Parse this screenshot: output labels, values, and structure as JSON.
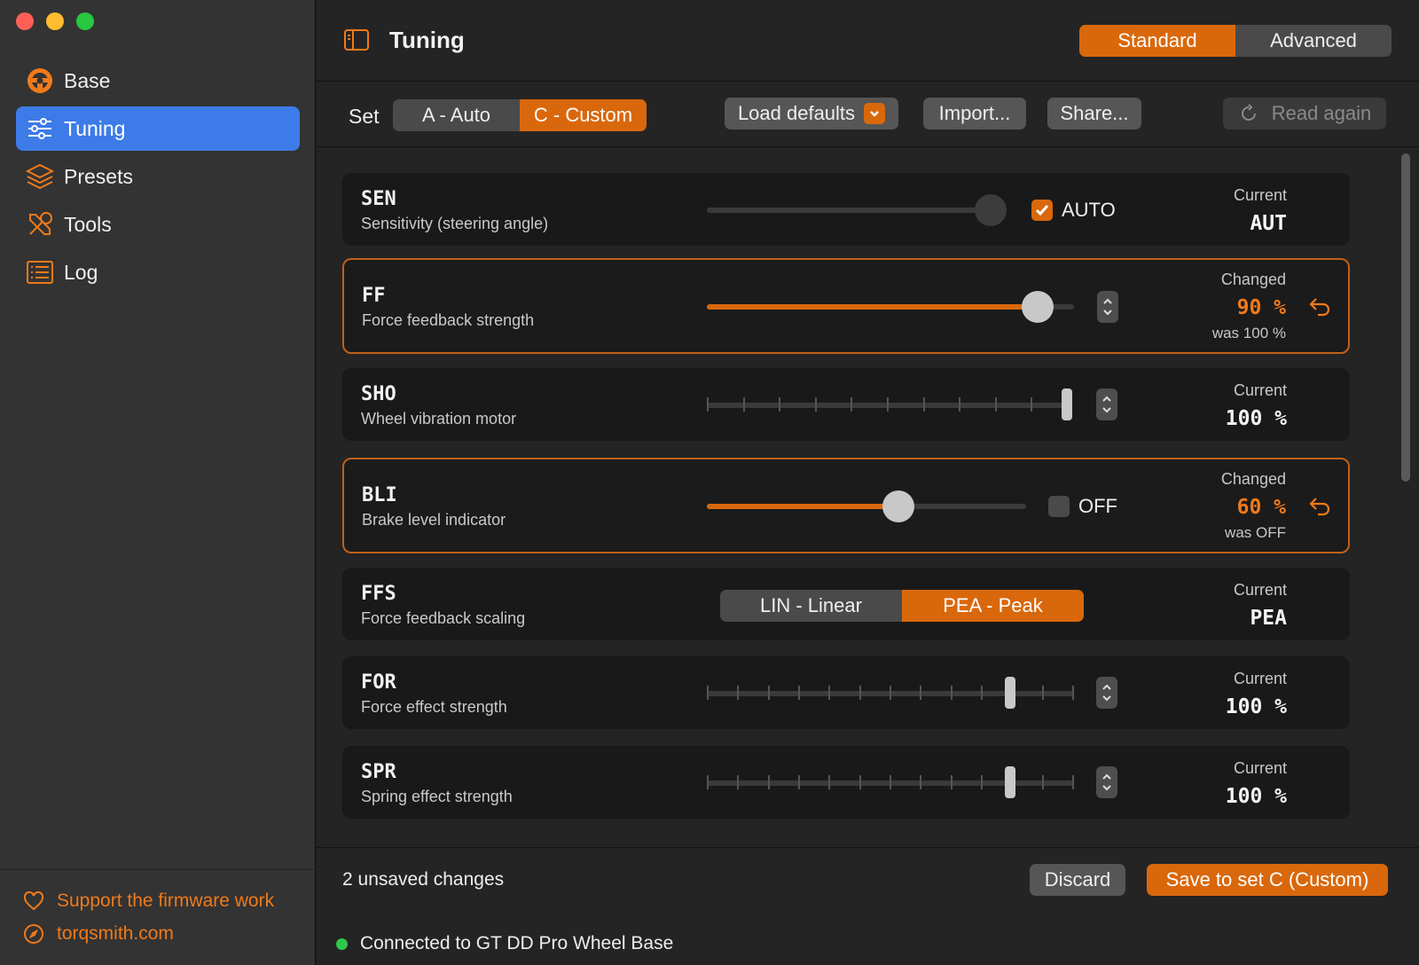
{
  "sidebar": {
    "items": [
      {
        "label": "Base",
        "icon": "steering-wheel-icon"
      },
      {
        "label": "Tuning",
        "icon": "sliders-icon",
        "active": true
      },
      {
        "label": "Presets",
        "icon": "layers-icon"
      },
      {
        "label": "Tools",
        "icon": "tools-icon"
      },
      {
        "label": "Log",
        "icon": "list-icon"
      }
    ],
    "support_label": "Support the firmware work",
    "website_label": "torqsmith.com"
  },
  "header": {
    "title": "Tuning",
    "mode_options": [
      "Standard",
      "Advanced"
    ],
    "mode_selected": "Standard"
  },
  "toolbar": {
    "set_label": "Set",
    "set_options": [
      "A - Auto",
      "C - Custom"
    ],
    "set_selected": "C - Custom",
    "load_defaults_label": "Load defaults",
    "import_label": "Import...",
    "share_label": "Share...",
    "read_again_label": "Read again"
  },
  "params": [
    {
      "code": "SEN",
      "desc": "Sensitivity (steering angle)",
      "control": "slider",
      "value": 1.0,
      "checkbox_label": "AUTO",
      "checkbox_checked": true,
      "status_label": "Current",
      "status_value": "AUT",
      "changed": false
    },
    {
      "code": "FF",
      "desc": "Force feedback strength",
      "control": "slider",
      "value": 0.9,
      "status_label": "Changed",
      "status_value": "90 %",
      "was": "was 100 %",
      "changed": true
    },
    {
      "code": "SHO",
      "desc": "Wheel vibration motor",
      "control": "ticked",
      "value": 1.0,
      "status_label": "Current",
      "status_value": "100 %",
      "changed": false
    },
    {
      "code": "BLI",
      "desc": "Brake level indicator",
      "control": "slider",
      "value": 0.6,
      "checkbox_label": "OFF",
      "checkbox_checked": false,
      "status_label": "Changed",
      "status_value": "60 %",
      "was": "was OFF",
      "changed": true
    },
    {
      "code": "FFS",
      "desc": "Force feedback scaling",
      "control": "segmented",
      "options": [
        "LIN - Linear",
        "PEA - Peak"
      ],
      "selected": "PEA - Peak",
      "status_label": "Current",
      "status_value": "PEA",
      "changed": false
    },
    {
      "code": "FOR",
      "desc": "Force effect strength",
      "control": "ticked",
      "value": 0.83,
      "status_label": "Current",
      "status_value": "100 %",
      "changed": false
    },
    {
      "code": "SPR",
      "desc": "Spring effect strength",
      "control": "ticked",
      "value": 0.83,
      "status_label": "Current",
      "status_value": "100 %",
      "changed": false
    }
  ],
  "footer": {
    "unsaved_text": "2 unsaved changes",
    "discard_label": "Discard",
    "save_label": "Save to set C (Custom)",
    "connection_text": "Connected to GT DD Pro Wheel Base"
  },
  "colors": {
    "accent": "#d9680c",
    "active_nav": "#3d7be8",
    "connected": "#2fc84a"
  }
}
